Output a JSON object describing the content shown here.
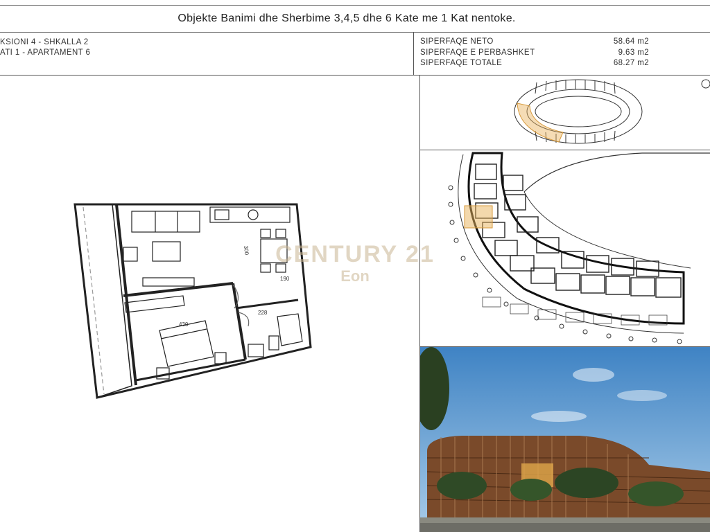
{
  "document": {
    "title": "Objekte Banimi dhe Sherbime 3,4,5 dhe 6 Kate me 1 Kat nentoke.",
    "section_line": "KSIONI 4 - SHKALLA 2",
    "floor_line": "ATI 1 - APARTAMENT 6"
  },
  "areas": [
    {
      "label": "SIPERFAQE NETO",
      "value": "58.64 m2"
    },
    {
      "label": "SIPERFAQE E PERBASHKET",
      "value": "9.63 m2"
    },
    {
      "label": "SIPERFAQE TOTALE",
      "value": "68.27 m2"
    }
  ],
  "plan_dimensions": {
    "living": "300",
    "bedroom": "430",
    "bath": "228",
    "hall": "190"
  },
  "watermark": {
    "brand": "CENTURY 21",
    "office": "Eon"
  },
  "colors": {
    "highlight": "#e8b25a",
    "sky": "#4f8fc8",
    "facade": "#7a4a2a",
    "line": "#222222"
  }
}
